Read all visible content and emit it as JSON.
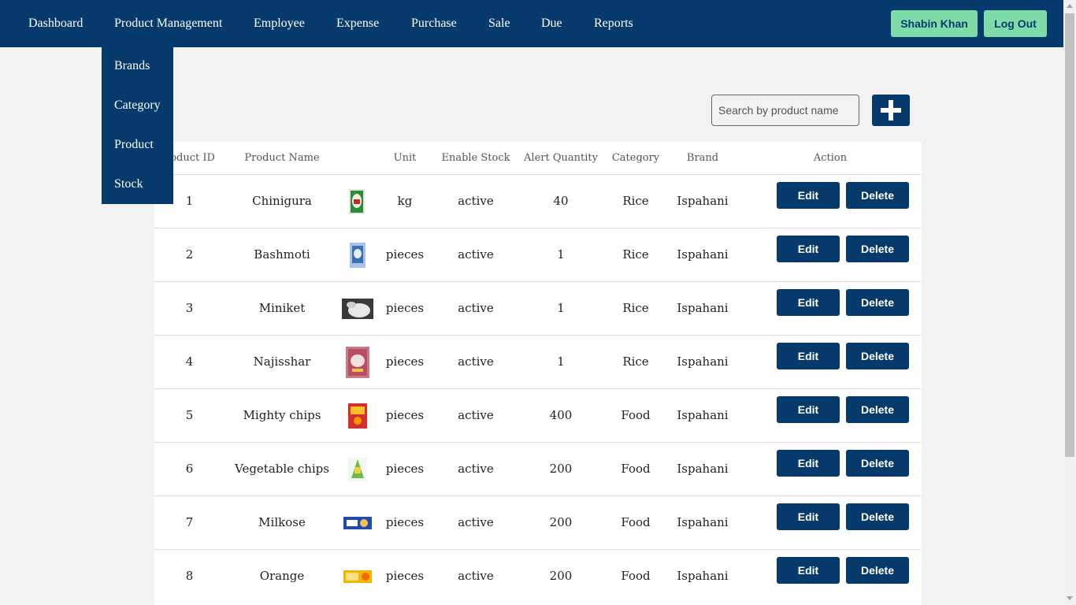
{
  "nav": {
    "items": [
      "Dashboard",
      "Product Management",
      "Employee",
      "Expense",
      "Purchase",
      "Sale",
      "Due",
      "Reports"
    ],
    "user_label": "Shabin Khan",
    "logout_label": "Log Out"
  },
  "dropdown": {
    "items": [
      "Brands",
      "Category",
      "Product",
      "Stock"
    ]
  },
  "search": {
    "placeholder": "Search by product name",
    "value": ""
  },
  "table": {
    "headers": [
      "roduct ID",
      "Product Name",
      "Unit",
      "Enable Stock",
      "Alert Quantity",
      "Category",
      "Brand",
      "Action"
    ],
    "rows": [
      {
        "id": "1",
        "name": "Chinigura",
        "unit": "kg",
        "stock": "active",
        "alert": "40",
        "category": "Rice",
        "brand": "Ispahani",
        "image": "chinigura-package"
      },
      {
        "id": "2",
        "name": "Bashmoti",
        "unit": "pieces",
        "stock": "active",
        "alert": "1",
        "category": "Rice",
        "brand": "Ispahani",
        "image": "bashmoti-package"
      },
      {
        "id": "3",
        "name": "Miniket",
        "unit": "pieces",
        "stock": "active",
        "alert": "1",
        "category": "Rice",
        "brand": "Ispahani",
        "image": "miniket-rice"
      },
      {
        "id": "4",
        "name": "Najisshar",
        "unit": "pieces",
        "stock": "active",
        "alert": "1",
        "category": "Rice",
        "brand": "Ispahani",
        "image": "najisshar-package"
      },
      {
        "id": "5",
        "name": "Mighty chips",
        "unit": "pieces",
        "stock": "active",
        "alert": "400",
        "category": "Food",
        "brand": "Ispahani",
        "image": "mighty-chips-pack"
      },
      {
        "id": "6",
        "name": "Vegetable chips",
        "unit": "pieces",
        "stock": "active",
        "alert": "200",
        "category": "Food",
        "brand": "Ispahani",
        "image": "vegetable-chips-pack"
      },
      {
        "id": "7",
        "name": "Milkose",
        "unit": "pieces",
        "stock": "active",
        "alert": "200",
        "category": "Food",
        "brand": "Ispahani",
        "image": "milkose-biscuit"
      },
      {
        "id": "8",
        "name": "Orange",
        "unit": "pieces",
        "stock": "active",
        "alert": "200",
        "category": "Food",
        "brand": "Ispahani",
        "image": "orange-biscuit"
      }
    ],
    "edit_label": "Edit",
    "delete_label": "Delete"
  },
  "colors": {
    "navbar": "#063a6c",
    "accent_button": "#7ddca8",
    "action_button": "#063a6c",
    "background": "#f2f2f2"
  }
}
